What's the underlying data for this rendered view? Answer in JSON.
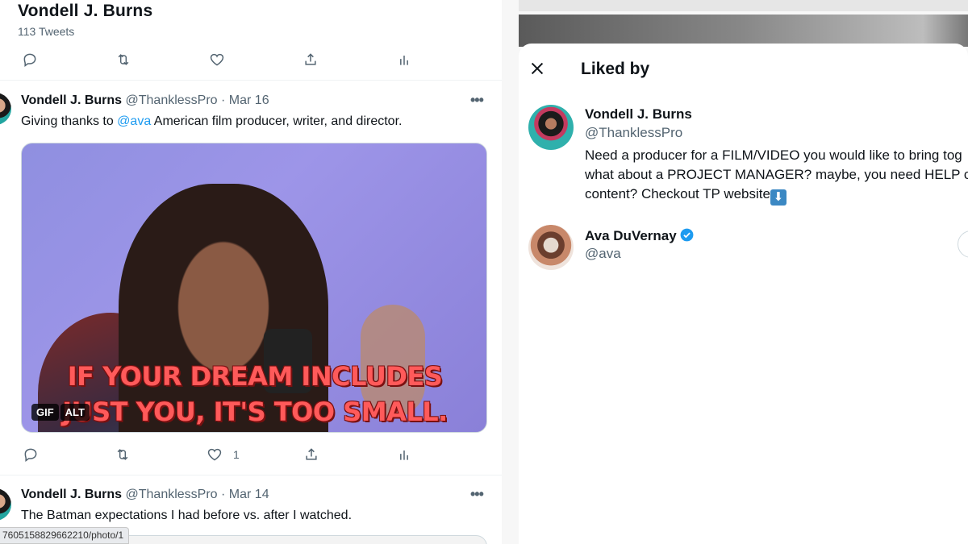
{
  "profile_header": {
    "name": "Vondell J. Burns",
    "tweet_count": "113 Tweets"
  },
  "tweets": [
    {
      "name": "Vondell J. Burns",
      "handle": "@ThanklessPro",
      "date": "· Mar 16",
      "text_before": "Giving thanks to ",
      "mention": "@ava",
      "text_after": " American film producer, writer, and director.",
      "media": {
        "caption_line1": "IF YOUR DREAM INCLUDES",
        "caption_line2": "JUST YOU, IT'S TOO SMALL.",
        "badge_gif": "GIF",
        "badge_alt": "ALT"
      },
      "like_count": "1"
    },
    {
      "name": "Vondell J. Burns",
      "handle": "@ThanklessPro",
      "date": "· Mar 14",
      "text": "The Batman expectations I had before vs. after I watched."
    }
  ],
  "status_bar": {
    "url": "7605158829662210/photo/1"
  },
  "modal": {
    "title": "Liked by",
    "users": [
      {
        "name": "Vondell J. Burns",
        "handle": "@ThanklessPro",
        "bio_line1": "Need a producer for a FILM/VIDEO you would like to bring tog",
        "bio_line2": "what about a PROJECT MANAGER? maybe, you need HELP c",
        "bio_line3": "content? Checkout TP website",
        "verified": false
      },
      {
        "name": "Ava DuVernay",
        "handle": "@ava",
        "verified": true
      }
    ]
  },
  "colors": {
    "accent": "#1d9bf0",
    "secondary_text": "#536471",
    "caption": "#ff5a5a"
  }
}
